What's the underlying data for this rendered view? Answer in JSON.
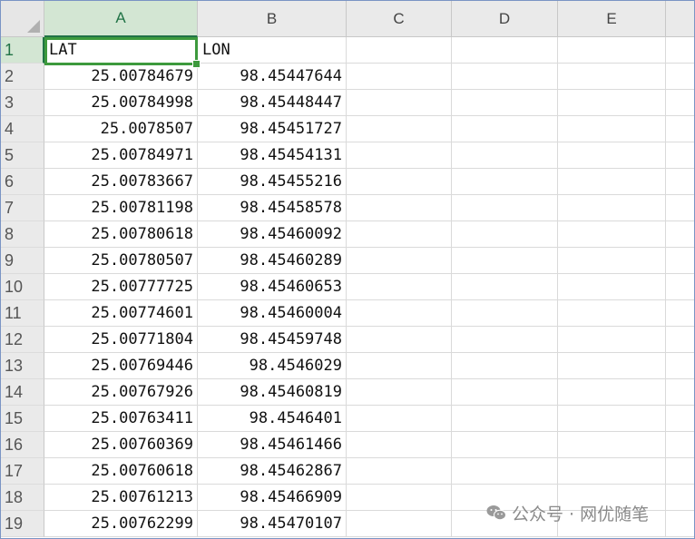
{
  "sheet": {
    "columns": [
      "A",
      "B",
      "C",
      "D",
      "E"
    ],
    "selected_cell": "A1",
    "rows": [
      {
        "num": "1",
        "A": "LAT",
        "B": "LON"
      },
      {
        "num": "2",
        "A": "25.00784679",
        "B": "98.45447644"
      },
      {
        "num": "3",
        "A": "25.00784998",
        "B": "98.45448447"
      },
      {
        "num": "4",
        "A": "25.0078507",
        "B": "98.45451727"
      },
      {
        "num": "5",
        "A": "25.00784971",
        "B": "98.45454131"
      },
      {
        "num": "6",
        "A": "25.00783667",
        "B": "98.45455216"
      },
      {
        "num": "7",
        "A": "25.00781198",
        "B": "98.45458578"
      },
      {
        "num": "8",
        "A": "25.00780618",
        "B": "98.45460092"
      },
      {
        "num": "9",
        "A": "25.00780507",
        "B": "98.45460289"
      },
      {
        "num": "10",
        "A": "25.00777725",
        "B": "98.45460653"
      },
      {
        "num": "11",
        "A": "25.00774601",
        "B": "98.45460004"
      },
      {
        "num": "12",
        "A": "25.00771804",
        "B": "98.45459748"
      },
      {
        "num": "13",
        "A": "25.00769446",
        "B": "98.4546029"
      },
      {
        "num": "14",
        "A": "25.00767926",
        "B": "98.45460819"
      },
      {
        "num": "15",
        "A": "25.00763411",
        "B": "98.4546401"
      },
      {
        "num": "16",
        "A": "25.00760369",
        "B": "98.45461466"
      },
      {
        "num": "17",
        "A": "25.00760618",
        "B": "98.45462867"
      },
      {
        "num": "18",
        "A": "25.00761213",
        "B": "98.45466909"
      },
      {
        "num": "19",
        "A": "25.00762299",
        "B": "98.45470107"
      }
    ]
  },
  "watermark": {
    "icon": "wechat-icon",
    "text": "公众号 · 网优随笔",
    "color": "#8a8a8a"
  },
  "colors": {
    "selection_border": "#3d9a3d",
    "header_selected": "#217346"
  }
}
